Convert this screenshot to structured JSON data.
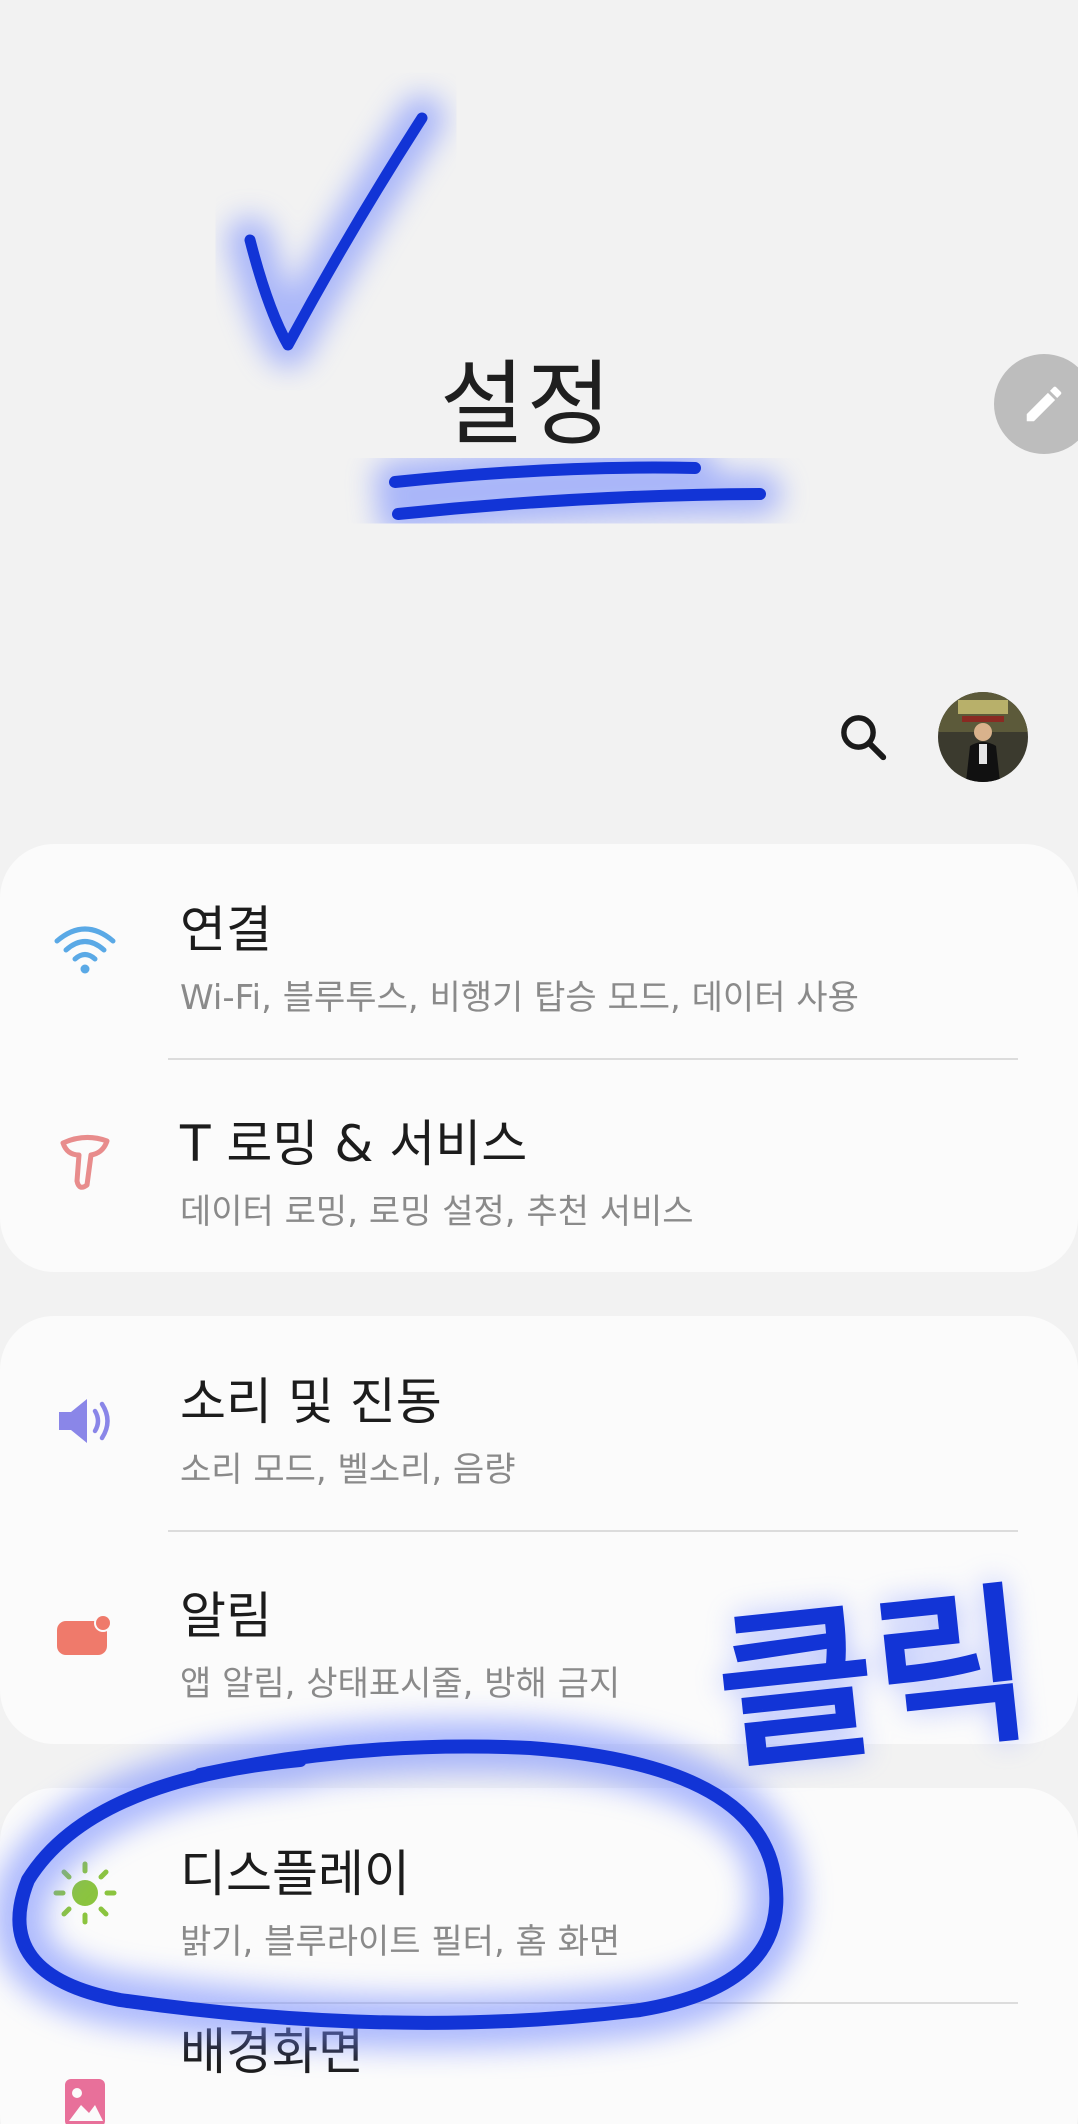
{
  "header": {
    "title": "설정"
  },
  "sections": [
    {
      "items": [
        {
          "label": "연결",
          "sub": "Wi-Fi, 블루투스, 비행기 탑승 모드, 데이터 사용"
        },
        {
          "label": "T 로밍 & 서비스",
          "sub": "데이터 로밍, 로밍 설정, 추천 서비스"
        }
      ]
    },
    {
      "items": [
        {
          "label": "소리 및 진동",
          "sub": "소리 모드, 벨소리, 음량"
        },
        {
          "label": "알림",
          "sub": "앱 알림, 상태표시줄, 방해 금지"
        }
      ]
    },
    {
      "items": [
        {
          "label": "디스플레이",
          "sub": "밝기, 블루라이트 필터, 홈 화면"
        },
        {
          "label": "배경화면",
          "sub": ""
        }
      ]
    }
  ],
  "annotation": {
    "click_text": "클릭"
  },
  "icons": {
    "wifi": "wifi-icon",
    "roaming": "t-roaming-icon",
    "sound": "speaker-icon",
    "notification": "notification-icon",
    "display": "brightness-icon",
    "wallpaper": "wallpaper-icon",
    "search": "search-icon",
    "edit": "pencil-icon"
  },
  "colors": {
    "background": "#f2f2f2",
    "card": "#fbfbfb",
    "wifi": "#5aa9e6",
    "roaming": "#e88c8c",
    "sound": "#8a86e8",
    "notification": "#ef7a6b",
    "display": "#8bc43f",
    "wallpaper": "#e8709a",
    "annotation_ink": "#1234d6"
  }
}
